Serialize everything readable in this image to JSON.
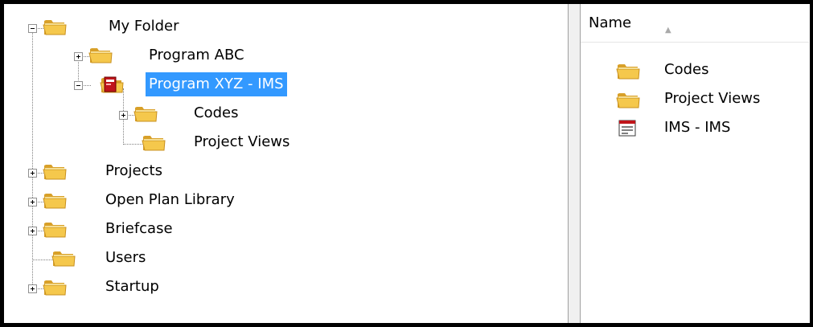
{
  "tree": {
    "root": {
      "label": "My Folder"
    },
    "program_abc": {
      "label": "Program ABC"
    },
    "program_xyz": {
      "label": "Program XYZ - IMS"
    },
    "codes": {
      "label": "Codes"
    },
    "project_views": {
      "label": "Project Views"
    },
    "projects": {
      "label": "Projects"
    },
    "open_plan_library": {
      "label": "Open Plan Library"
    },
    "briefcase": {
      "label": "Briefcase"
    },
    "users": {
      "label": "Users"
    },
    "startup": {
      "label": "Startup"
    }
  },
  "list": {
    "column_header": "Name",
    "items": [
      {
        "label": "Codes",
        "icon": "folder-icon"
      },
      {
        "label": "Project Views",
        "icon": "folder-icon"
      },
      {
        "label": "IMS - IMS",
        "icon": "ims-document-icon"
      }
    ]
  },
  "colors": {
    "selection": "#3399ff",
    "folder": "#f5c84c",
    "folder_dark": "#d8a029",
    "ims_red": "#c0151b"
  }
}
